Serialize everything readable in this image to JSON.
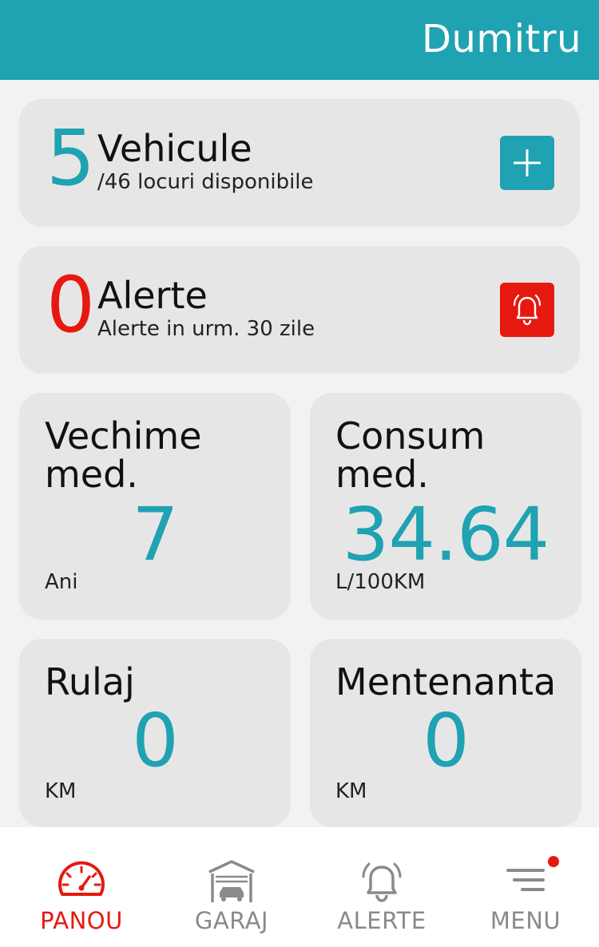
{
  "header": {
    "user_name": "Dumitru"
  },
  "vehicles_card": {
    "count": "5",
    "title": "Vehicule",
    "subtitle": "/46 locuri disponibile",
    "action_icon": "plus-icon"
  },
  "alerts_card": {
    "count": "0",
    "title": "Alerte",
    "subtitle": "Alerte in urm. 30 zile",
    "action_icon": "bell-icon"
  },
  "stats": {
    "age": {
      "title": "Vechime med.",
      "value": "7",
      "unit": "Ani"
    },
    "consumption": {
      "title": "Consum med.",
      "value": "34.64",
      "unit": "L/100KM"
    },
    "mileage": {
      "title": "Rulaj",
      "value": "0",
      "unit": "KM"
    },
    "maintenance": {
      "title": "Mentenanta",
      "value": "0",
      "unit": "KM"
    }
  },
  "bottom_nav": {
    "items": [
      {
        "label": "PANOU",
        "icon": "speedometer-icon",
        "active": true
      },
      {
        "label": "GARAJ",
        "icon": "garage-icon",
        "active": false
      },
      {
        "label": "ALERTE",
        "icon": "bell-icon",
        "active": false
      },
      {
        "label": "MENU",
        "icon": "menu-icon",
        "active": false,
        "badge": true
      }
    ]
  },
  "colors": {
    "accent": "#1fa2b2",
    "alert": "#e6190f",
    "card_bg": "#e7e6e7",
    "page_bg": "#f3f2f3",
    "inactive_nav": "#8a8a8a"
  }
}
